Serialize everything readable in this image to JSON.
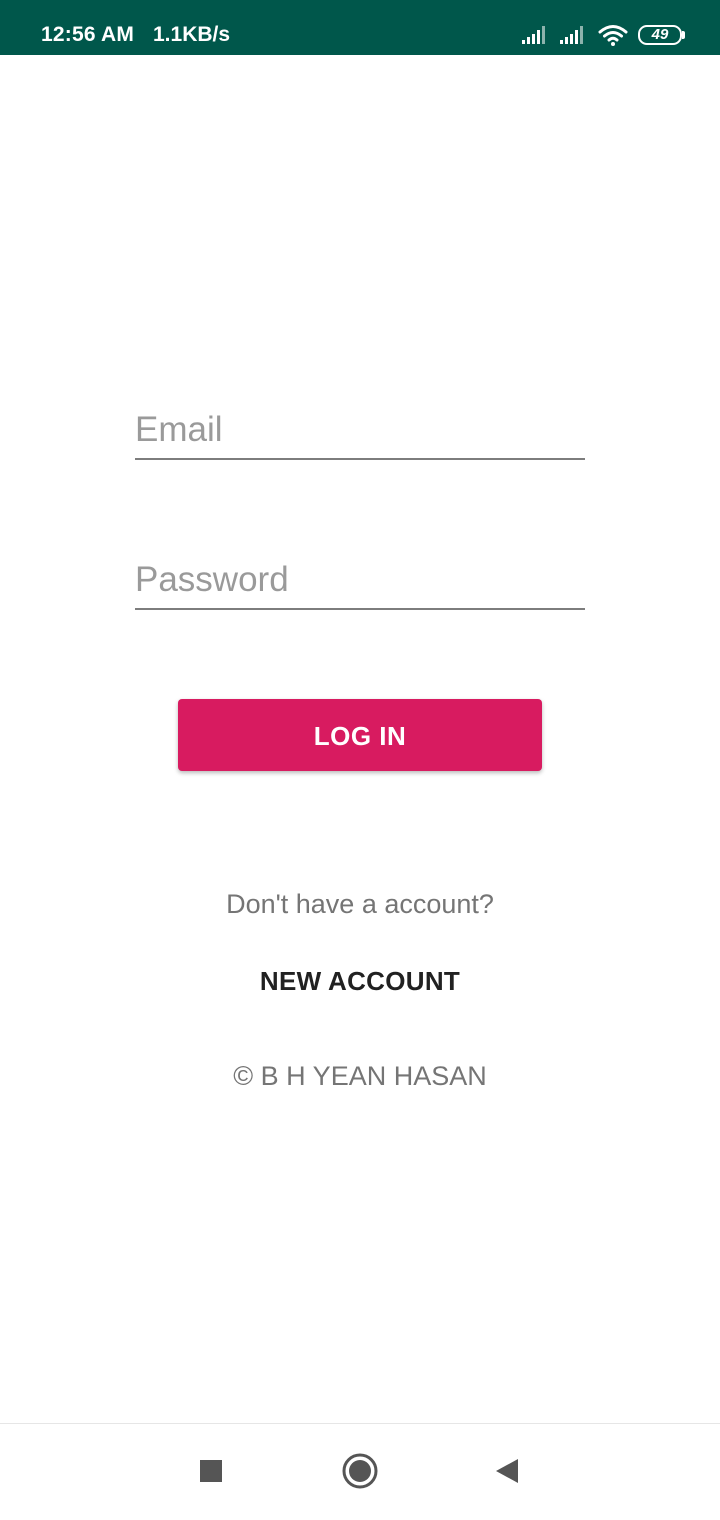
{
  "status_bar": {
    "time": "12:56 AM",
    "network_speed": "1.1KB/s",
    "battery_level": "49",
    "icons": [
      "signal-icon",
      "signal-icon",
      "wifi-icon",
      "battery-icon"
    ]
  },
  "login_form": {
    "email": {
      "placeholder": "Email",
      "value": ""
    },
    "password": {
      "placeholder": "Password",
      "value": ""
    },
    "login_label": "LOG IN"
  },
  "signup": {
    "prompt": "Don't have a account?",
    "new_account_label": "NEW ACCOUNT"
  },
  "footer": {
    "copyright": "© B H YEAN HASAN"
  },
  "nav_bar": {
    "icons": [
      "recents-icon",
      "home-icon",
      "back-icon"
    ]
  },
  "colors": {
    "status_bar": "#00574b",
    "accent": "#d81b60",
    "text_secondary": "#757575"
  }
}
